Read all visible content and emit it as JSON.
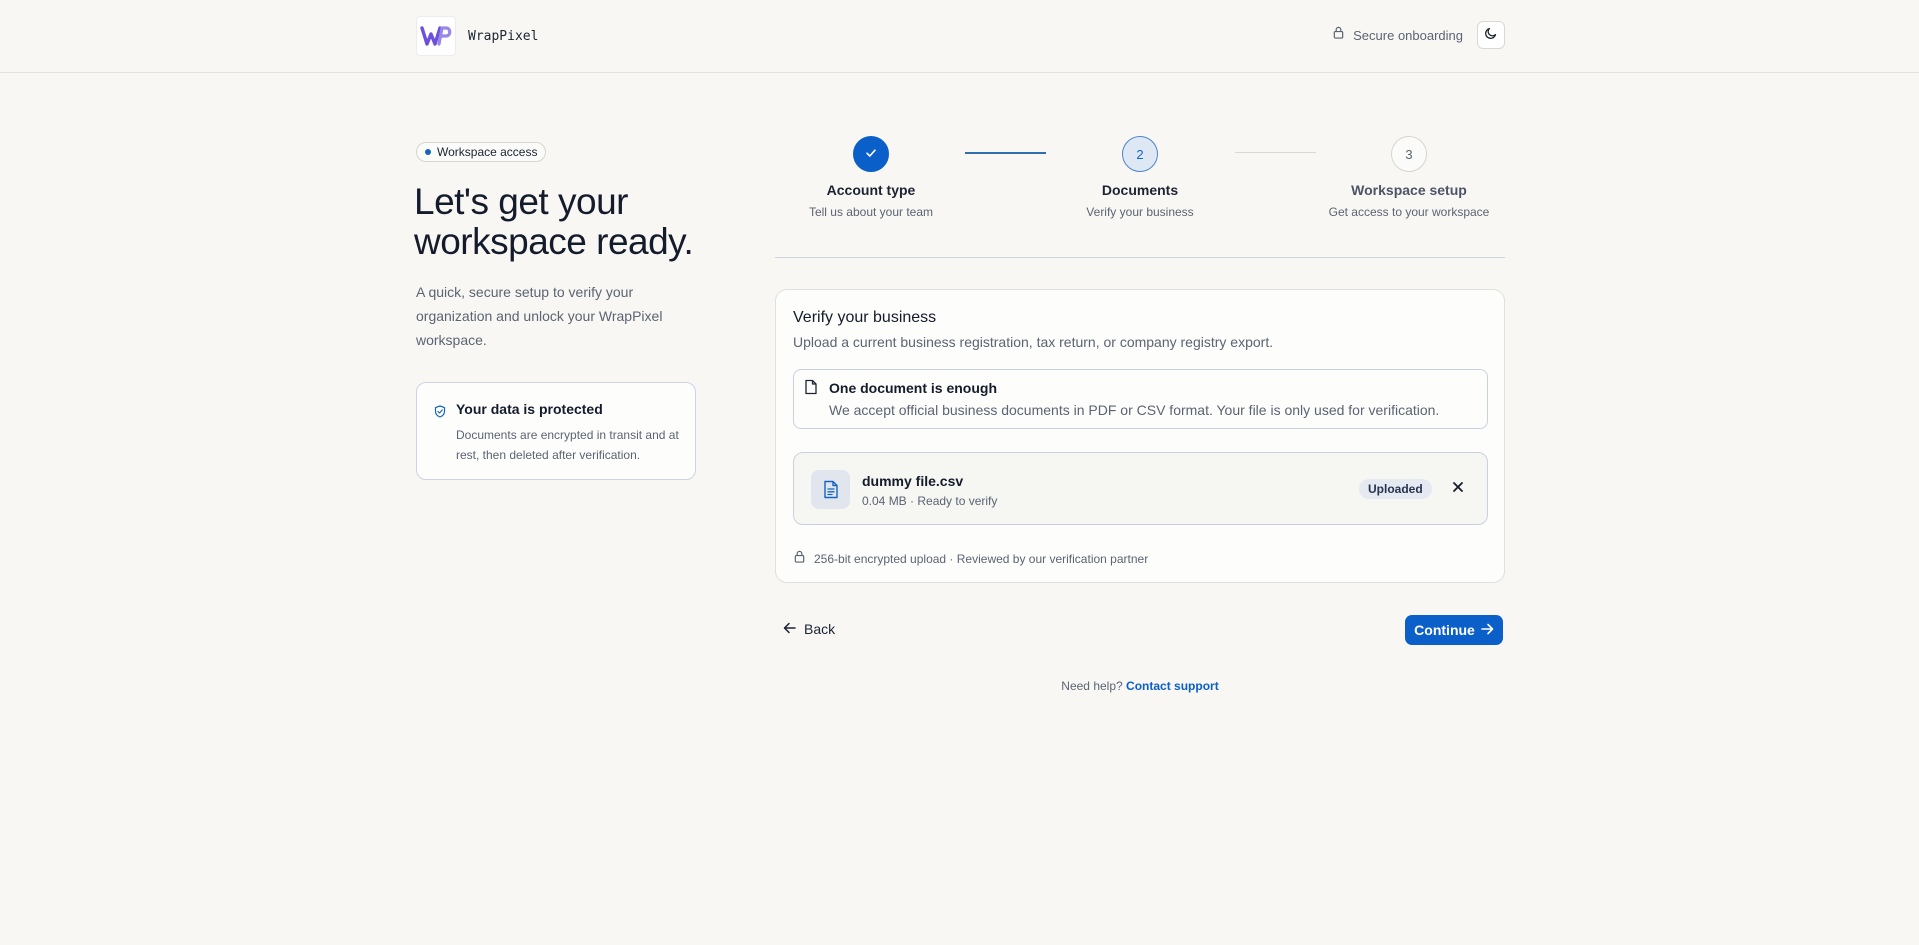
{
  "header": {
    "brand_name": "WrapPixel",
    "secure_label": "Secure onboarding",
    "icons": [
      "wrappixel-logo-icon",
      "lock-icon",
      "moon-icon"
    ]
  },
  "intro": {
    "badge": "Workspace access",
    "title": "Let's get your workspace ready.",
    "subtitle": "A quick, secure setup to verify your organization and unlock your WrapPixel workspace.",
    "protect_title": "Your data is protected",
    "protect_text": "Documents are encrypted in transit and at rest, then deleted after verification."
  },
  "stepper": {
    "current_step": 2,
    "steps": [
      {
        "number": "1",
        "title": "Account type",
        "description": "Tell us about your team",
        "status": "complete"
      },
      {
        "number": "2",
        "title": "Documents",
        "description": "Verify your business",
        "status": "active"
      },
      {
        "number": "3",
        "title": "Workspace setup",
        "description": "Get access to your workspace",
        "status": "upcoming"
      }
    ]
  },
  "verify": {
    "title": "Verify your business",
    "subtitle": "Upload a current business registration, tax return, or company registry export.",
    "info_title": "One document is enough",
    "info_text": "We accept official business documents in PDF or CSV format. Your file is only used for verification.",
    "file": {
      "name": "dummy file.csv",
      "meta": "0.04 MB · Ready to verify",
      "status": "Uploaded"
    },
    "encryption_note": "256-bit encrypted upload · Reviewed by our verification partner"
  },
  "actions": {
    "back_label": "Back",
    "continue_label": "Continue"
  },
  "help": {
    "prefix": "Need help?",
    "link": "Contact support"
  },
  "colors": {
    "accent": "#0a5fc8",
    "background": "#f8f7f4",
    "text": "#141b2b",
    "muted_text": "#5b6472"
  }
}
